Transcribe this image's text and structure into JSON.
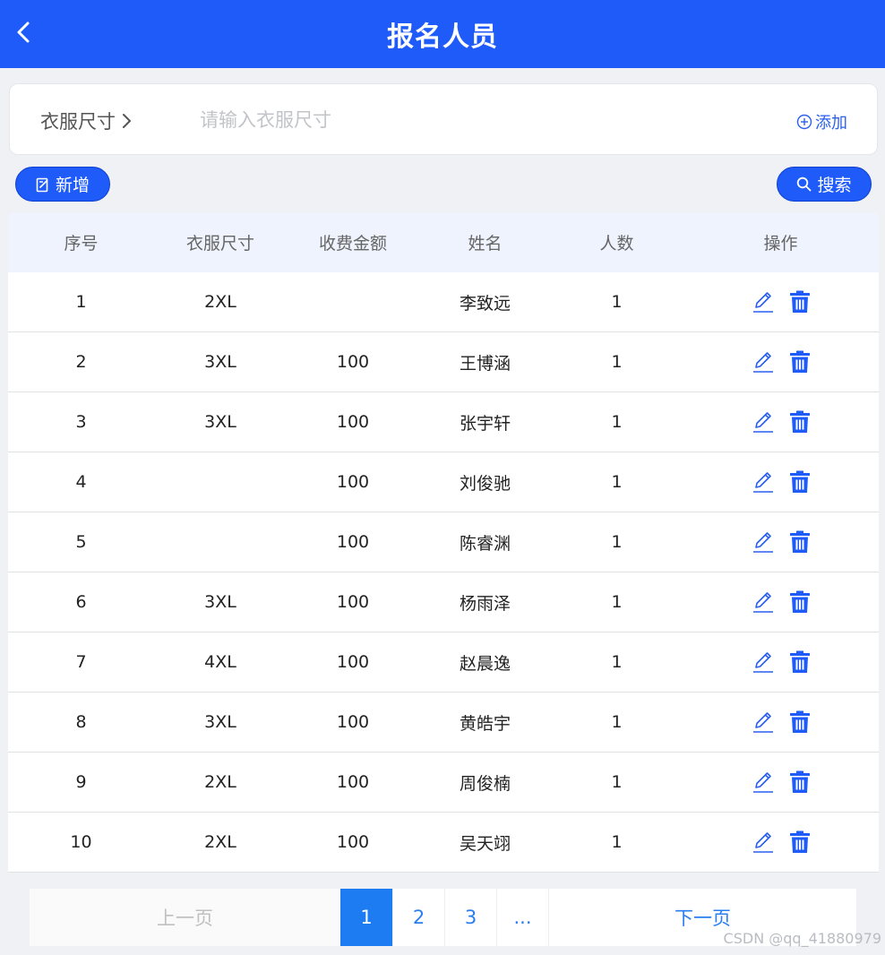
{
  "header": {
    "title": "报名人员",
    "back_icon": "chevron-left-icon"
  },
  "filter": {
    "label": "衣服尺寸",
    "placeholder": "请输入衣服尺寸",
    "value": "",
    "add_label": "添加",
    "add_icon": "circle-plus-icon"
  },
  "toolbar": {
    "new_label": "新增",
    "new_icon": "edit-note-icon",
    "search_label": "搜索",
    "search_icon": "search-icon"
  },
  "table": {
    "columns": [
      "序号",
      "衣服尺寸",
      "收费金额",
      "姓名",
      "人数",
      "操作"
    ],
    "rows": [
      [
        "1",
        "2XL",
        "",
        "李致远",
        "1"
      ],
      [
        "2",
        "3XL",
        "100",
        "王博涵",
        "1"
      ],
      [
        "3",
        "3XL",
        "100",
        "张宇轩",
        "1"
      ],
      [
        "4",
        "",
        "100",
        "刘俊驰",
        "1"
      ],
      [
        "5",
        "",
        "100",
        "陈睿渊",
        "1"
      ],
      [
        "6",
        "3XL",
        "100",
        "杨雨泽",
        "1"
      ],
      [
        "7",
        "4XL",
        "100",
        "赵晨逸",
        "1"
      ],
      [
        "8",
        "3XL",
        "100",
        "黄皓宇",
        "1"
      ],
      [
        "9",
        "2XL",
        "100",
        "周俊楠",
        "1"
      ],
      [
        "10",
        "2XL",
        "100",
        "吴天翊",
        "1"
      ]
    ],
    "row_action_icons": [
      "edit-icon",
      "trash-icon"
    ]
  },
  "pagination": {
    "prev_label": "上一页",
    "pages": [
      "1",
      "2",
      "3",
      "..."
    ],
    "current": "1",
    "next_label": "下一页"
  },
  "watermark": "CSDN @qq_41880979",
  "colors": {
    "primary": "#1f5bf8",
    "header_bg": "#1f5bf8",
    "page_active": "#1d7cf2",
    "table_head_bg": "#eef3fd"
  }
}
